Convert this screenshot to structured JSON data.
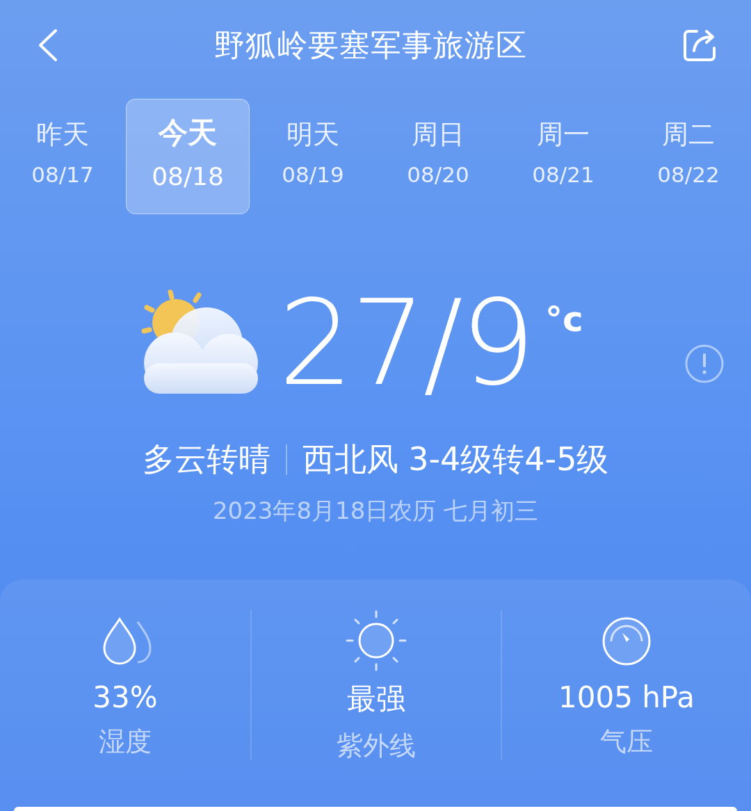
{
  "header": {
    "title": "野狐岭要塞军事旅游区"
  },
  "days": [
    {
      "label": "昨天",
      "date": "08/17",
      "selected": false
    },
    {
      "label": "今天",
      "date": "08/18",
      "selected": true
    },
    {
      "label": "明天",
      "date": "08/19",
      "selected": false
    },
    {
      "label": "周日",
      "date": "08/20",
      "selected": false
    },
    {
      "label": "周一",
      "date": "08/21",
      "selected": false
    },
    {
      "label": "周二",
      "date": "08/22",
      "selected": false
    }
  ],
  "current": {
    "temperature": "27/9",
    "unit": "°c",
    "condition": "多云转晴",
    "wind": "西北风 3-4级转4-5级",
    "date": "2023年8月18日农历 七月初三"
  },
  "stats": [
    {
      "kind": "humidity",
      "value": "33%",
      "label": "湿度"
    },
    {
      "kind": "uv",
      "value": "最强",
      "label": "紫外线"
    },
    {
      "kind": "pressure",
      "value": "1005 hPa",
      "label": "气压"
    }
  ]
}
